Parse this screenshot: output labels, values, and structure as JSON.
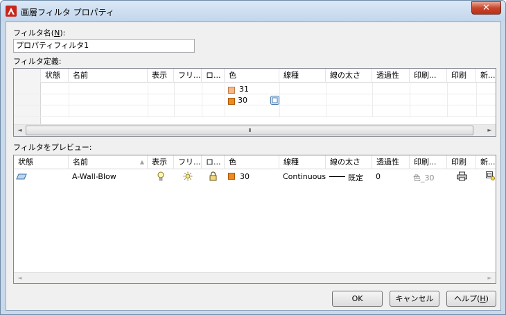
{
  "window": {
    "title": "画層フィルタ プロパティ",
    "close_glyph": "✕",
    "icon": "autocad-logo-icon"
  },
  "filter_name": {
    "label_prefix": "フィルタ名(",
    "label_key": "N",
    "label_suffix": "):",
    "value": "プロパティフィルタ1"
  },
  "definition": {
    "label": "フィルタ定義:",
    "columns": [
      "状態",
      "名前",
      "表示",
      "フリ...",
      "ロ...",
      "色",
      "線種",
      "線の太さ",
      "透過性",
      "印刷...",
      "印刷",
      "新..."
    ],
    "rows": [
      {
        "color_value": "31",
        "color_hex": "#f7b78a"
      },
      {
        "color_value": "30",
        "color_hex": "#f08a1c",
        "edit_icon": "ellipsis-button-icon"
      }
    ]
  },
  "preview": {
    "label": "フィルタをプレビュー:",
    "columns": [
      "状態",
      "名前",
      "表示",
      "フリ...",
      "ロ...",
      "色",
      "線種",
      "線の太さ",
      "透過性",
      "印刷...",
      "印刷",
      "新..."
    ],
    "sort_indicator": "▲",
    "rows": [
      {
        "status_icon": "layer-status-icon",
        "name": "A-Wall-Blow",
        "on_icon": "lightbulb-icon",
        "freeze_icon": "sun-icon",
        "lock_icon": "padlock-icon",
        "color_value": "30",
        "color_hex": "#f08a1c",
        "linetype": "Continuous",
        "lineweight": "既定",
        "transparency": "0",
        "plot_style": "色_30",
        "plot_icon": "printer-icon",
        "newvp_icon": "new-viewport-freeze-icon"
      }
    ]
  },
  "scroll": {
    "thumb_glyph": "III",
    "left_arrow": "◄",
    "right_arrow": "►"
  },
  "buttons": {
    "ok": "OK",
    "cancel": "キャンセル",
    "help_prefix": "ヘルプ(",
    "help_key": "H",
    "help_suffix": ")"
  }
}
